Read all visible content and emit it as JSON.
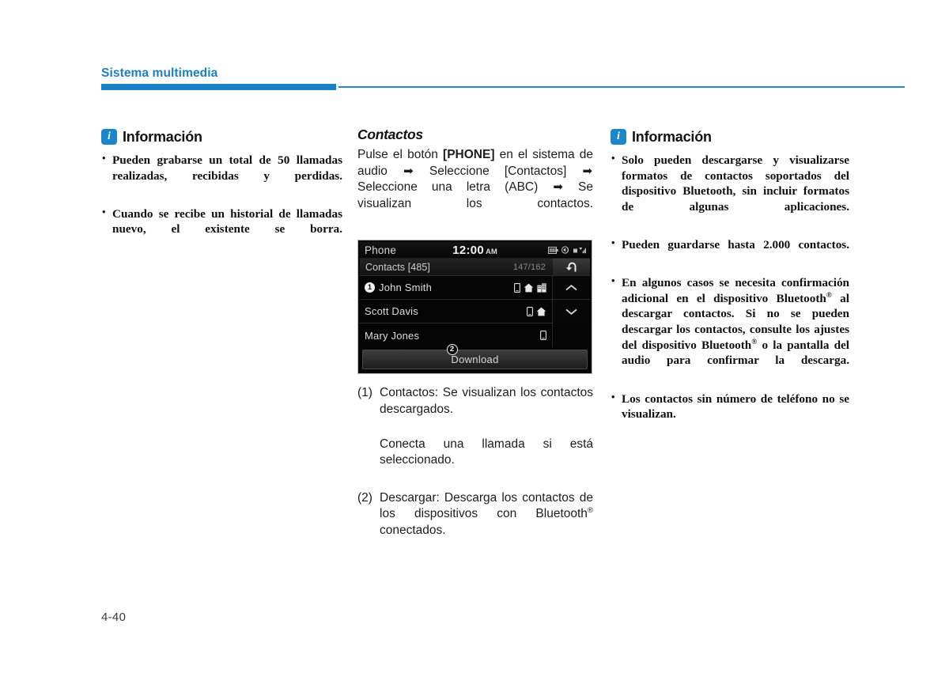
{
  "header": {
    "chapter_title": "Sistema multimedia",
    "rule_color": "#1b80c5"
  },
  "left_column": {
    "info_box": {
      "icon": "info-icon",
      "title": "Información",
      "items": [
        "Pueden grabarse un total de 50 llamadas realizadas, recibidas y perdidas.",
        "Cuando se recibe un historial de llamadas nuevo, el existente se borra."
      ]
    }
  },
  "middle_column": {
    "section_title": "Contactos",
    "intro_parts": {
      "p1": "Pulse el botón ",
      "phone_button": "[PHONE]",
      "p2": " en el sistema de audio ",
      "arrow1": "➡",
      "p3": " Seleccione [Contactos] ",
      "arrow2": "➡",
      "p4": " Seleccione una letra (ABC) ",
      "arrow3": "➡",
      "p5": " Se visualizan los contactos."
    },
    "head_unit": {
      "app_name": "Phone",
      "clock_time": "12:00",
      "clock_ampm": "AM",
      "status_icons": [
        "battery-icon",
        "mute-sound-icon",
        "signal-icon"
      ],
      "list_title": "Contacts [485]",
      "counter": "147/162",
      "rows": [
        {
          "callout": "1",
          "name": "John Smith",
          "icons": [
            "mobile-icon",
            "home-icon",
            "office-icon"
          ]
        },
        {
          "callout": "",
          "name": "Scott Davis",
          "icons": [
            "mobile-icon",
            "home-icon"
          ]
        },
        {
          "callout": "",
          "name": "Mary Jones",
          "icons": [
            "mobile-icon"
          ]
        }
      ],
      "nav_icons": [
        "back-icon",
        "chevron-up-icon",
        "chevron-down-icon"
      ],
      "download_label": "Download",
      "download_callout": "2"
    },
    "numbered_notes": [
      {
        "key": "(1)",
        "value": "Contactos: Se visualizan los contactos descargados.",
        "sub": "Conecta una llamada si está seleccionado."
      },
      {
        "key": "(2)",
        "value_pre": "Descargar: Descarga los contactos de los dispositivos con Bluetooth",
        "value_sup": "®",
        "value_post": " conectados."
      }
    ]
  },
  "right_column": {
    "info_box": {
      "icon": "info-icon",
      "title": "Información",
      "items": [
        {
          "pre": "Solo pueden descargarse y visualizarse formatos de contactos soportados del dispositivo Bluetooth, sin incluir formatos de algunas aplicaciones."
        },
        {
          "pre": "Pueden guardarse hasta 2.000 contactos."
        },
        {
          "pre": "En algunos casos se necesita confirmación adicional en el dispositivo Bluetooth",
          "sup1": "®",
          "mid": " al descargar contactos. Si no se pueden descargar los contactos, consulte los ajustes del dispositivo Bluetooth",
          "sup2": "®",
          "post": " o la pantalla del audio para confirmar la descarga."
        },
        {
          "pre": "Los contactos sin número de teléfono no se visualizan."
        }
      ]
    }
  },
  "footer": {
    "page_number": "4-40"
  }
}
